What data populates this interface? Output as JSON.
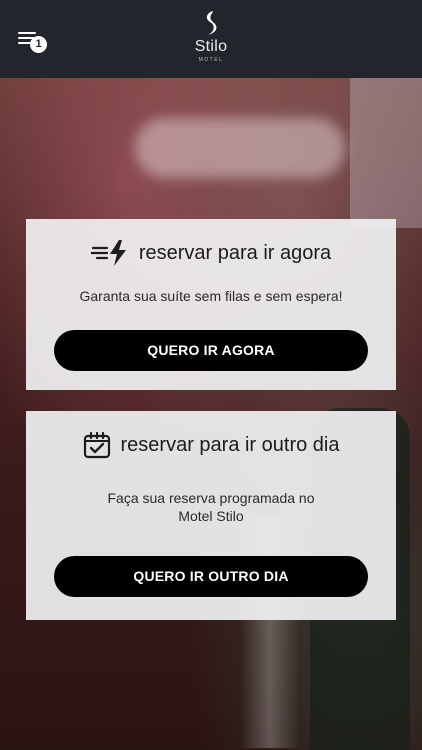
{
  "header": {
    "menu_badge": "1",
    "logo_name": "Stilo",
    "logo_sub": "MOTEL"
  },
  "now_card": {
    "icon": "fast-lightning-icon",
    "title": "reservar para ir agora",
    "description": "Garanta sua suíte sem filas e sem espera!",
    "button_label": "QUERO IR AGORA"
  },
  "later_card": {
    "icon": "calendar-check-icon",
    "title": "reservar para ir outro dia",
    "description": "Faça sua reserva programada no Motel Stilo",
    "button_label": "QUERO IR OUTRO DIA"
  },
  "colors": {
    "topbar": "#22252b",
    "button": "#000000",
    "card": "#f0f0f2"
  }
}
